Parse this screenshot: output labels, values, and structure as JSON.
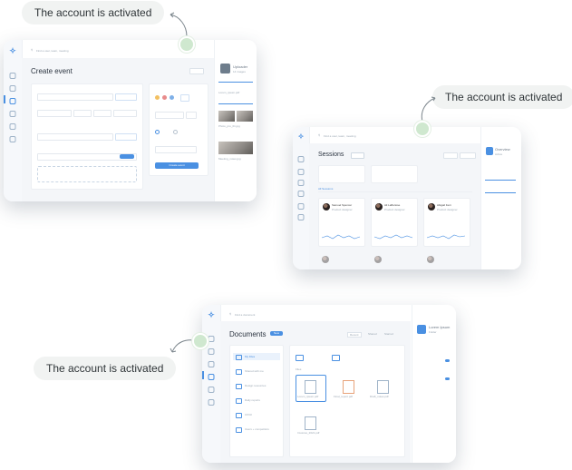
{
  "callouts": {
    "text_1": "The account is activated",
    "text_2": "The account is activated",
    "text_3": "The account is activated"
  },
  "event_card": {
    "search_placeholder": "Find a user, team, meeting",
    "title": "Create event",
    "right_panel": {
      "uploader_title": "Uploader",
      "uploader_sub": "14 images",
      "files": [
        "Lorem_ipsum.pdf",
        "Photo_pro_01.jpg",
        "Meeting_notes.jpg",
        "Agenda.jpg"
      ]
    },
    "button": "Create event"
  },
  "sessions_card": {
    "search_placeholder": "Find a user, team, meeting",
    "title": "Sessions",
    "tab": "All Sessions",
    "people": [
      {
        "name": "Samuel Spencer",
        "role": "Product designer"
      },
      {
        "name": "Ali Lafferiose",
        "role": "Product designer"
      },
      {
        "name": "Abigail Fern",
        "role": "Product designer"
      }
    ],
    "right_panel": {
      "title": "Overview",
      "sub": "Active"
    }
  },
  "documents_card": {
    "search_placeholder": "Find a document",
    "title": "Documents",
    "badge": "New",
    "filters": [
      "Recent",
      "Shared",
      "Starred"
    ],
    "folders": [
      "My Files",
      "Shared with me",
      "Design resources",
      "Daily reports",
      "UX/UI",
      "Users + competitors"
    ],
    "section_label": "Files",
    "files": [
      "Lorem_ipsum.pdf",
      "Final_report.pdf",
      "Draft_notes.pdf",
      "Invoices_2021.pdf"
    ],
    "right_panel": {
      "title": "Lorem Ipsum",
      "sub": "Folder"
    }
  }
}
